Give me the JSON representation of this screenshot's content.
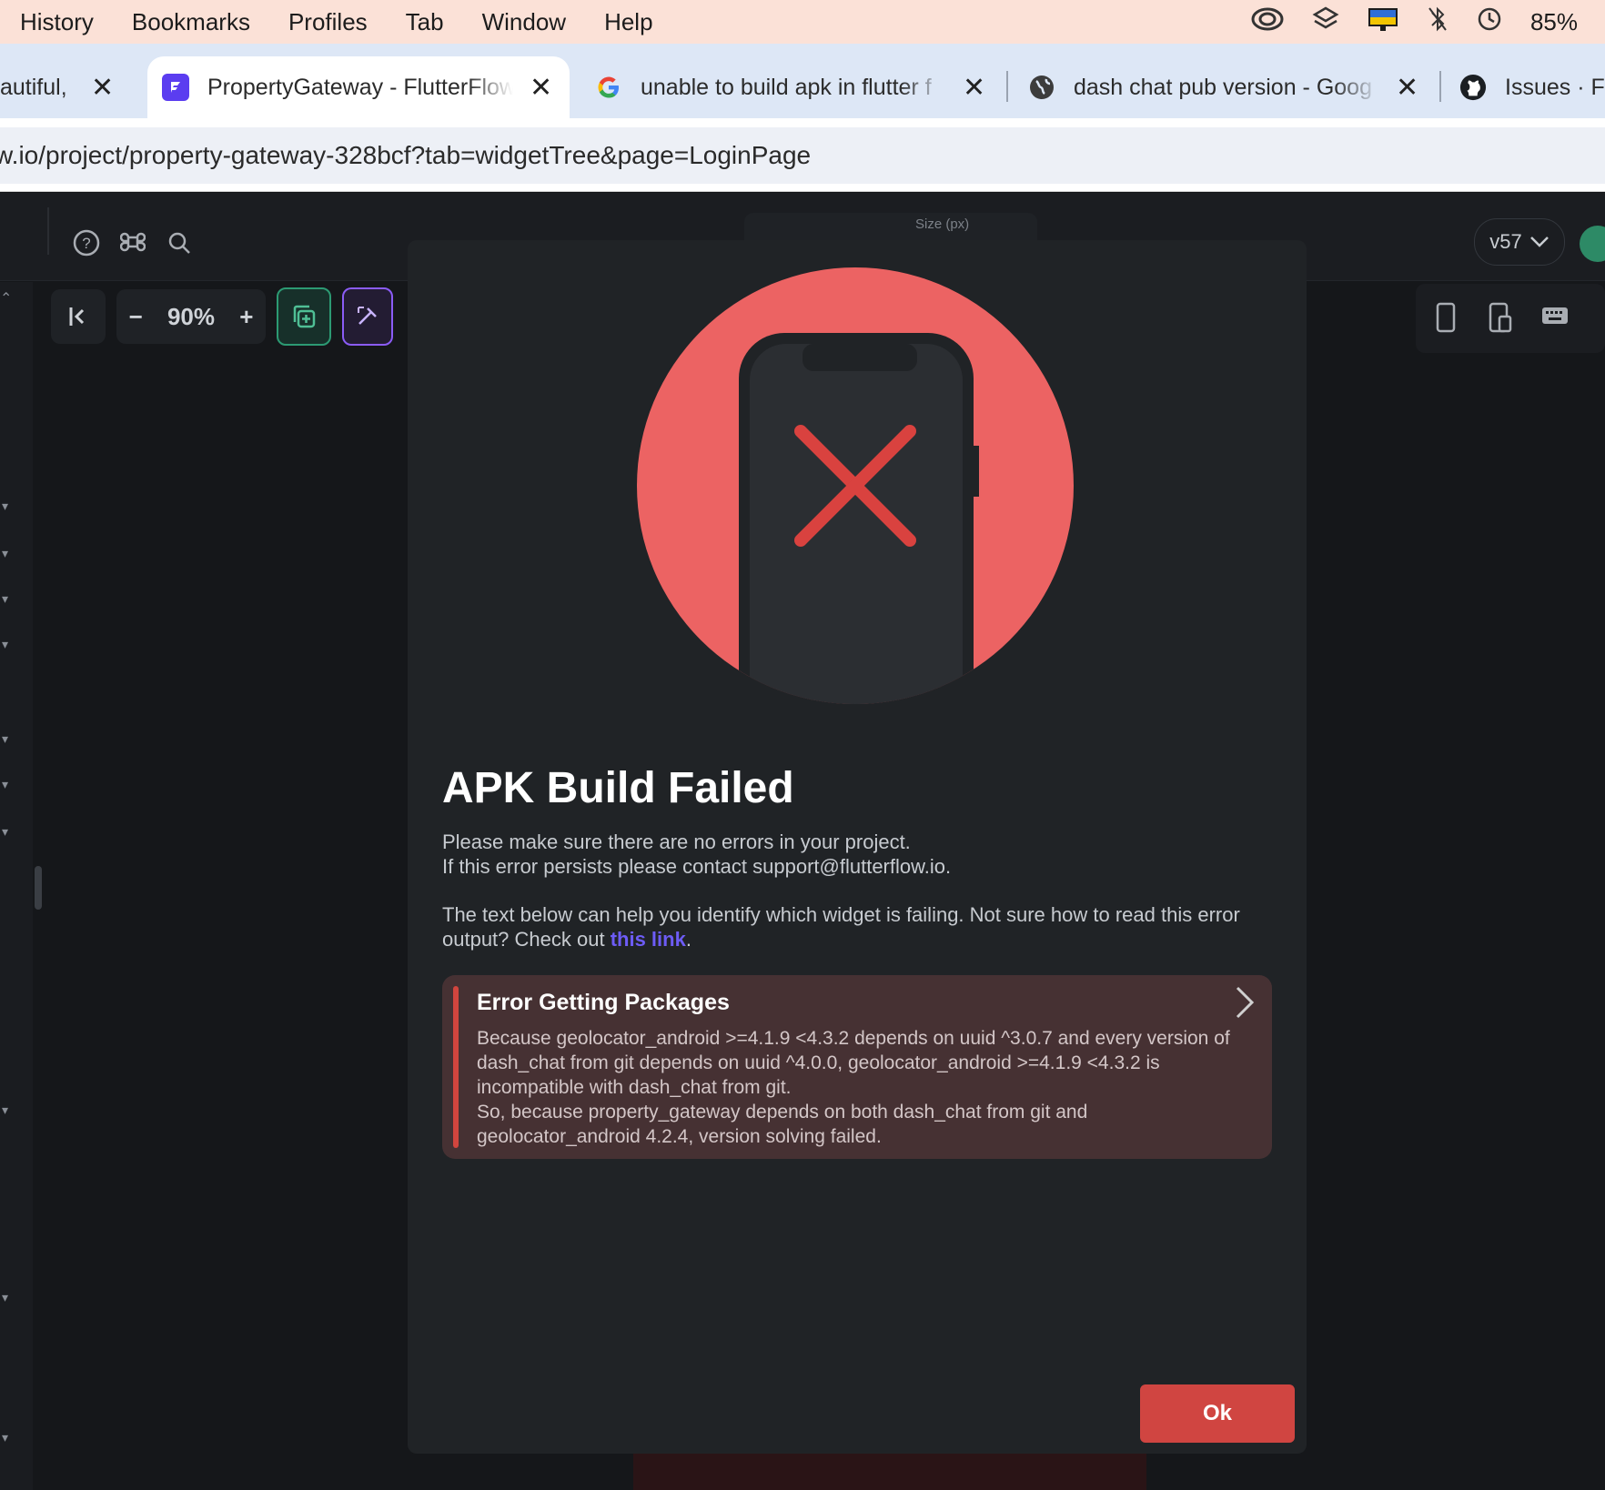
{
  "menubar": {
    "items": [
      "History",
      "Bookmarks",
      "Profiles",
      "Tab",
      "Window",
      "Help"
    ],
    "battery": "85%"
  },
  "tabs": [
    {
      "title": "autiful, r",
      "close": "✕"
    },
    {
      "title": "PropertyGateway - FlutterFlow",
      "close": "✕"
    },
    {
      "title": "unable to build apk in flutter f",
      "close": "✕"
    },
    {
      "title": "dash chat pub version - Goog",
      "close": "✕"
    },
    {
      "title": "Issues · Fl"
    }
  ],
  "address": {
    "url": "w.io/project/property-gateway-328bcf?tab=widgetTree&page=LoginPage"
  },
  "app": {
    "zoom": "90%",
    "version": "v57",
    "size_label": "Size (px)"
  },
  "modal": {
    "title": "APK Build Failed",
    "line1": "Please make sure there are no errors in your project.",
    "line2": "If this error persists please contact support@flutterflow.io.",
    "help_prefix": "The text below can help you identify which widget is failing. Not sure how to read this error output? Check out ",
    "help_link": "this link",
    "help_suffix": ".",
    "error_title": "Error Getting Packages",
    "error_body": "Because geolocator_android >=4.1.9 <4.3.2 depends on uuid ^3.0.7 and every version of dash_chat from git depends on uuid ^4.0.0, geolocator_android >=4.1.9 <4.3.2 is incompatible with dash_chat from git.\nSo, because property_gateway depends on both dash_chat from git and geolocator_android 4.2.4, version solving failed.",
    "ok_label": "Ok"
  },
  "colors": {
    "accent_red": "#d04541",
    "hero_circle": "#ec6363",
    "link": "#6d5cf6",
    "error_bg": "#463133"
  }
}
